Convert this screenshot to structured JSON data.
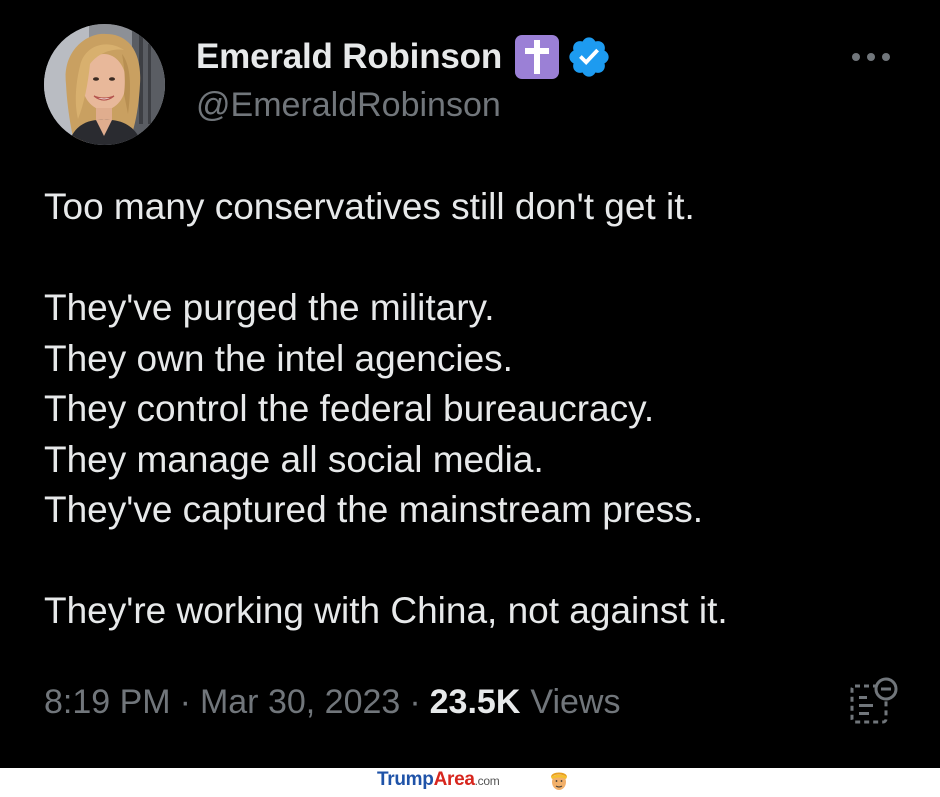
{
  "tweet": {
    "author": {
      "display_name": "Emerald Robinson",
      "handle": "@EmeraldRobinson"
    },
    "badges": [
      "cross-icon",
      "verified-icon"
    ],
    "lines": [
      "Too many conservatives still don't get it.",
      "",
      "They've purged the military.",
      "They own the intel agencies.",
      "They control the federal bureaucracy.",
      "They manage all social media.",
      "They've captured the mainstream press.",
      "",
      "They're working with China, not against it."
    ],
    "meta": {
      "time": "8:19 PM",
      "separator": "·",
      "date": "Mar 30, 2023",
      "views_count": "23.5K",
      "views_label": "Views"
    },
    "icons": {
      "more": "more-dots-icon",
      "analytics": "analytics-icon"
    }
  },
  "watermark": {
    "brand_part1": "Trump",
    "brand_part2": "Area",
    "brand_suffix": ".com",
    "logo": "trump-head-logo-icon"
  },
  "colors": {
    "background": "#000000",
    "text_primary": "#e7e9ea",
    "text_secondary": "#71767b",
    "verified_blue": "#1d9bf0",
    "cross_badge_purple": "#9b80d6",
    "watermark_blue": "#1f53a8",
    "watermark_red": "#d7261e"
  }
}
